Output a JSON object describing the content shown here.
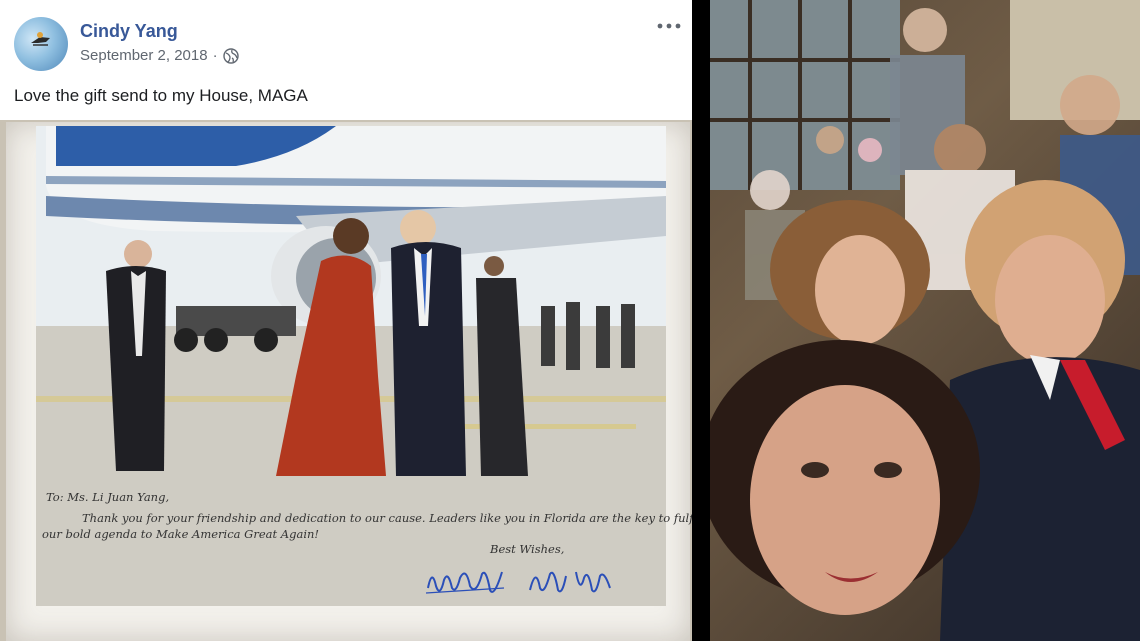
{
  "post": {
    "author": "Cindy Yang",
    "date": "September 2, 2018",
    "date_separator": "·",
    "privacy_icon": "globe-icon",
    "more_icon": "more-options-icon",
    "text": "Love the gift send to my House, MAGA"
  },
  "letter": {
    "to": "To: Ms. Li Juan Yang,",
    "body_line1": "Thank you for your friendship and dedication to our cause.  Leaders like you in Florida are the key to fulfilling",
    "body_line2": "our bold agenda to Make America Great Again!",
    "closing": "Best Wishes,"
  },
  "colors": {
    "author_link": "#385898",
    "meta_text": "#606770",
    "signature_ink": "#2b4fb8",
    "divider": "#000000"
  }
}
